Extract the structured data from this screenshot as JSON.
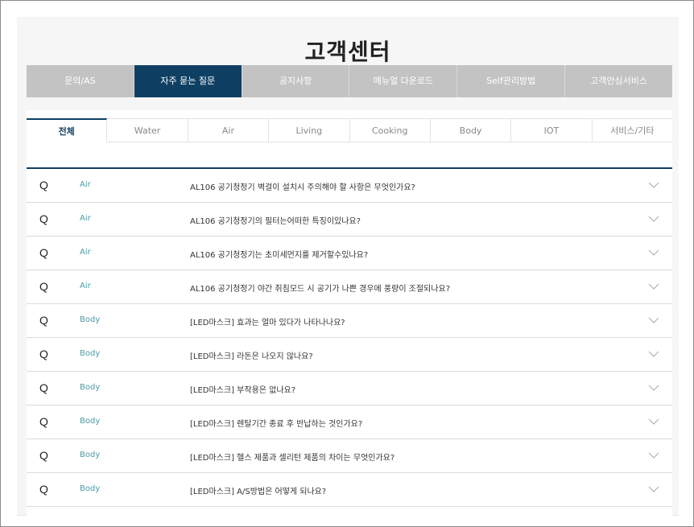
{
  "header": {
    "title": "고객센터"
  },
  "main_tabs": [
    {
      "label": "문의/AS",
      "active": false
    },
    {
      "label": "자주 묻는 질문",
      "active": true
    },
    {
      "label": "공지사항",
      "active": false
    },
    {
      "label": "메뉴얼 다운로드",
      "active": false
    },
    {
      "label": "Self관리방법",
      "active": false
    },
    {
      "label": "고객안심서비스",
      "active": false
    }
  ],
  "sub_tabs": [
    {
      "label": "전체",
      "active": true
    },
    {
      "label": "Water",
      "active": false
    },
    {
      "label": "Air",
      "active": false
    },
    {
      "label": "Living",
      "active": false
    },
    {
      "label": "Cooking",
      "active": false
    },
    {
      "label": "Body",
      "active": false
    },
    {
      "label": "IOT",
      "active": false
    },
    {
      "label": "서비스/기타",
      "active": false
    }
  ],
  "faq": {
    "q_mark": "Q",
    "items": [
      {
        "category": "Air",
        "question": "AL106 공기청정기 벽걸이 설치시 주의해야 할 사항은 무엇인가요?"
      },
      {
        "category": "Air",
        "question": "AL106 공기청정기의 필터는어떠한 특징이있나요?"
      },
      {
        "category": "Air",
        "question": "AL106 공기청정기는 초미세먼지를 제거할수있나요?"
      },
      {
        "category": "Air",
        "question": "AL106 공기청정기 야간 취침모드 시 공기가 나쁜 경우에 풍량이 조절되나요?"
      },
      {
        "category": "Body",
        "question": "[LED마스크] 효과는 얼마 있다가 나타나나요?"
      },
      {
        "category": "Body",
        "question": "[LED마스크] 라돈은 나오지 않나요?"
      },
      {
        "category": "Body",
        "question": "[LED마스크] 부작용은 없나요?"
      },
      {
        "category": "Body",
        "question": "[LED마스크] 렌탈기간 종료 후 반납하는 것인가요?"
      },
      {
        "category": "Body",
        "question": "[LED마스크] 헬스 제품과 셀리턴 제품의 차이는 무엇인가요?"
      },
      {
        "category": "Body",
        "question": "[LED마스크] A/S방법은 어떻게 되나요?"
      }
    ]
  },
  "colors": {
    "accent": "#0f3f63",
    "tab_gray": "#c3c3c3",
    "category": "#4e9aa6"
  },
  "icons": {
    "expand": "chevron-down-icon"
  }
}
